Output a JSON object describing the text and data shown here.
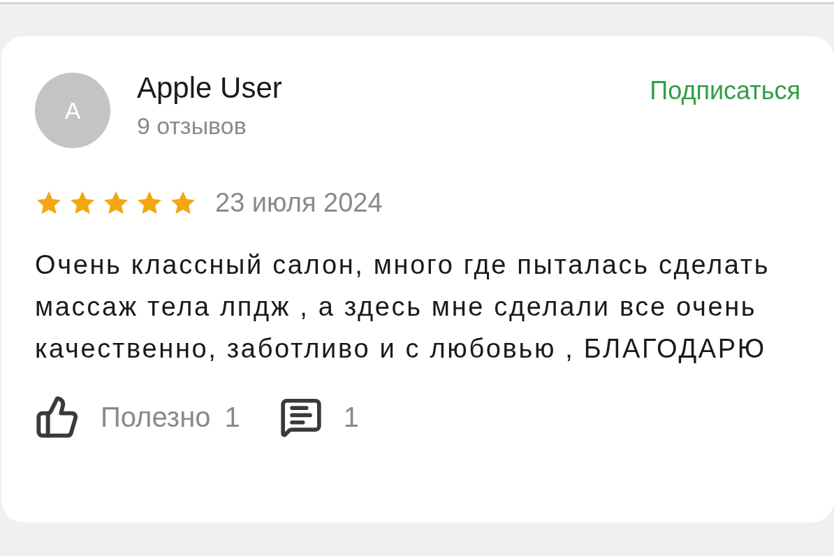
{
  "author": {
    "avatar_letter": "A",
    "name": "Apple User",
    "reviews_count": "9 отзывов"
  },
  "subscribe_button": "Подписаться",
  "rating": {
    "stars": 5,
    "date": "23 июля 2024"
  },
  "review_text": "Очень классный салон, много где пыталась сделать массаж тела лпдж , а здесь мне сделали все очень качественно, заботливо и с любовью , БЛАГОДАРЮ",
  "actions": {
    "helpful_label": "Полезно",
    "helpful_count": "1",
    "comments_count": "1"
  }
}
